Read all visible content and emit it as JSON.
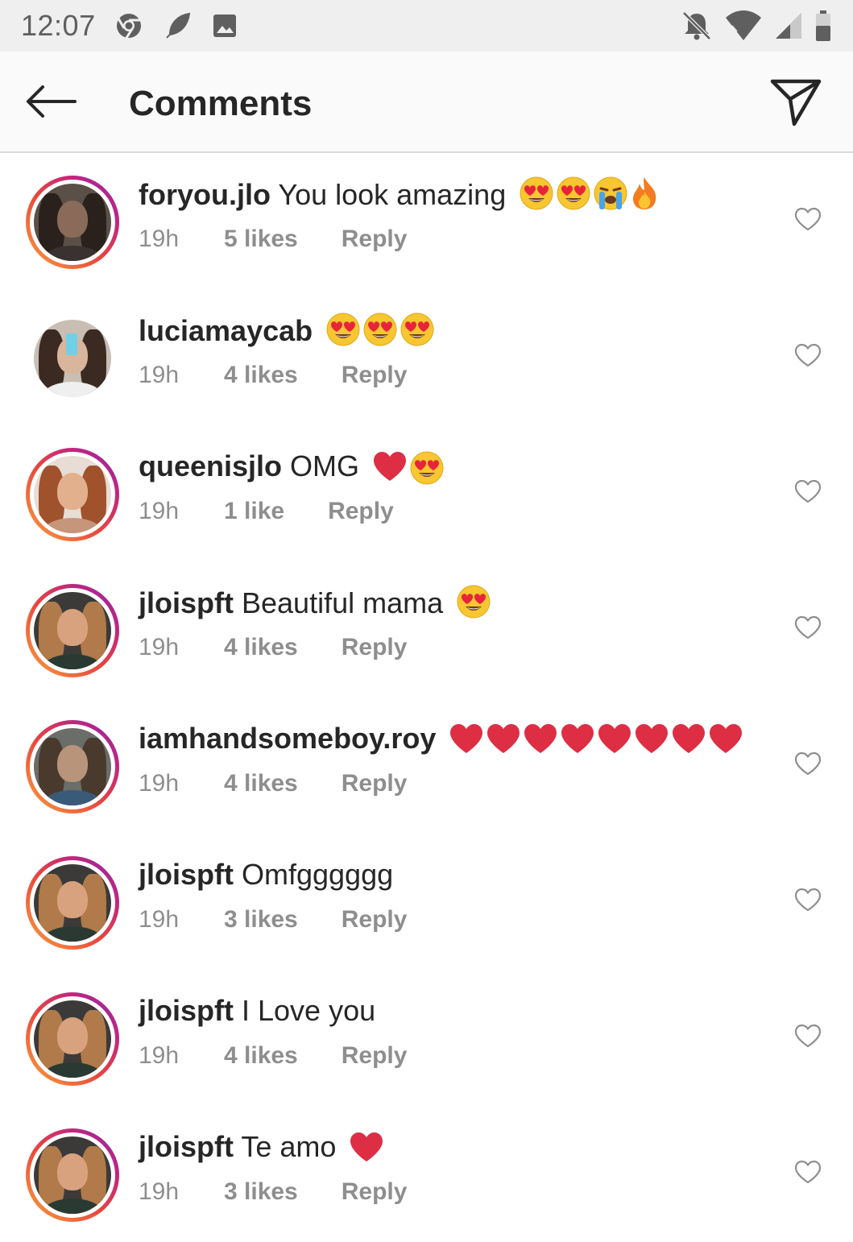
{
  "status_bar": {
    "time": "12:07",
    "left_icons": [
      "chrome-icon",
      "feather-icon",
      "image-icon"
    ],
    "right_icons": [
      "notifications-off-icon",
      "wifi-icon",
      "signal-icon",
      "battery-icon"
    ]
  },
  "header": {
    "title": "Comments"
  },
  "comments": [
    {
      "username": "foryou.jlo",
      "text": "You look amazing",
      "emojis": [
        "heart-eyes",
        "heart-eyes",
        "crying",
        "fire"
      ],
      "time": "19h",
      "likes": "5 likes",
      "reply": "Reply",
      "ring": true,
      "avatar": "dark"
    },
    {
      "username": "luciamaycab",
      "text": "",
      "emojis": [
        "heart-eyes",
        "heart-eyes",
        "heart-eyes"
      ],
      "time": "19h",
      "likes": "4 likes",
      "reply": "Reply",
      "ring": false,
      "avatar": "mirror"
    },
    {
      "username": "queenisjlo",
      "text": "OMG",
      "emojis": [
        "red-heart",
        "heart-eyes"
      ],
      "time": "19h",
      "likes": "1 like",
      "reply": "Reply",
      "ring": true,
      "avatar": "auburn"
    },
    {
      "username": "jloispft",
      "text": "Beautiful mama",
      "emojis": [
        "heart-eyes"
      ],
      "time": "19h",
      "likes": "4 likes",
      "reply": "Reply",
      "ring": true,
      "avatar": "curly"
    },
    {
      "username": "iamhandsomeboy.roy",
      "text": "",
      "emojis": [
        "red-heart",
        "red-heart",
        "red-heart",
        "red-heart",
        "red-heart",
        "red-heart",
        "red-heart",
        "red-heart"
      ],
      "time": "19h",
      "likes": "4 likes",
      "reply": "Reply",
      "ring": true,
      "avatar": "sitting"
    },
    {
      "username": "jloispft",
      "text": "Omfgggggg",
      "emojis": [],
      "time": "19h",
      "likes": "3 likes",
      "reply": "Reply",
      "ring": true,
      "avatar": "curly"
    },
    {
      "username": "jloispft",
      "text": "I Love you",
      "emojis": [],
      "time": "19h",
      "likes": "4 likes",
      "reply": "Reply",
      "ring": true,
      "avatar": "curly"
    },
    {
      "username": "jloispft",
      "text": "Te amo",
      "emojis": [
        "red-heart"
      ],
      "time": "19h",
      "likes": "3 likes",
      "reply": "Reply",
      "ring": true,
      "avatar": "curly"
    }
  ],
  "colors": {
    "text": "#262626",
    "secondary": "#8e8e8e",
    "header_bg": "#fafafa",
    "status_bg": "#efefef",
    "ring_start": "#f9a23c",
    "ring_end": "#8a2bb0"
  }
}
